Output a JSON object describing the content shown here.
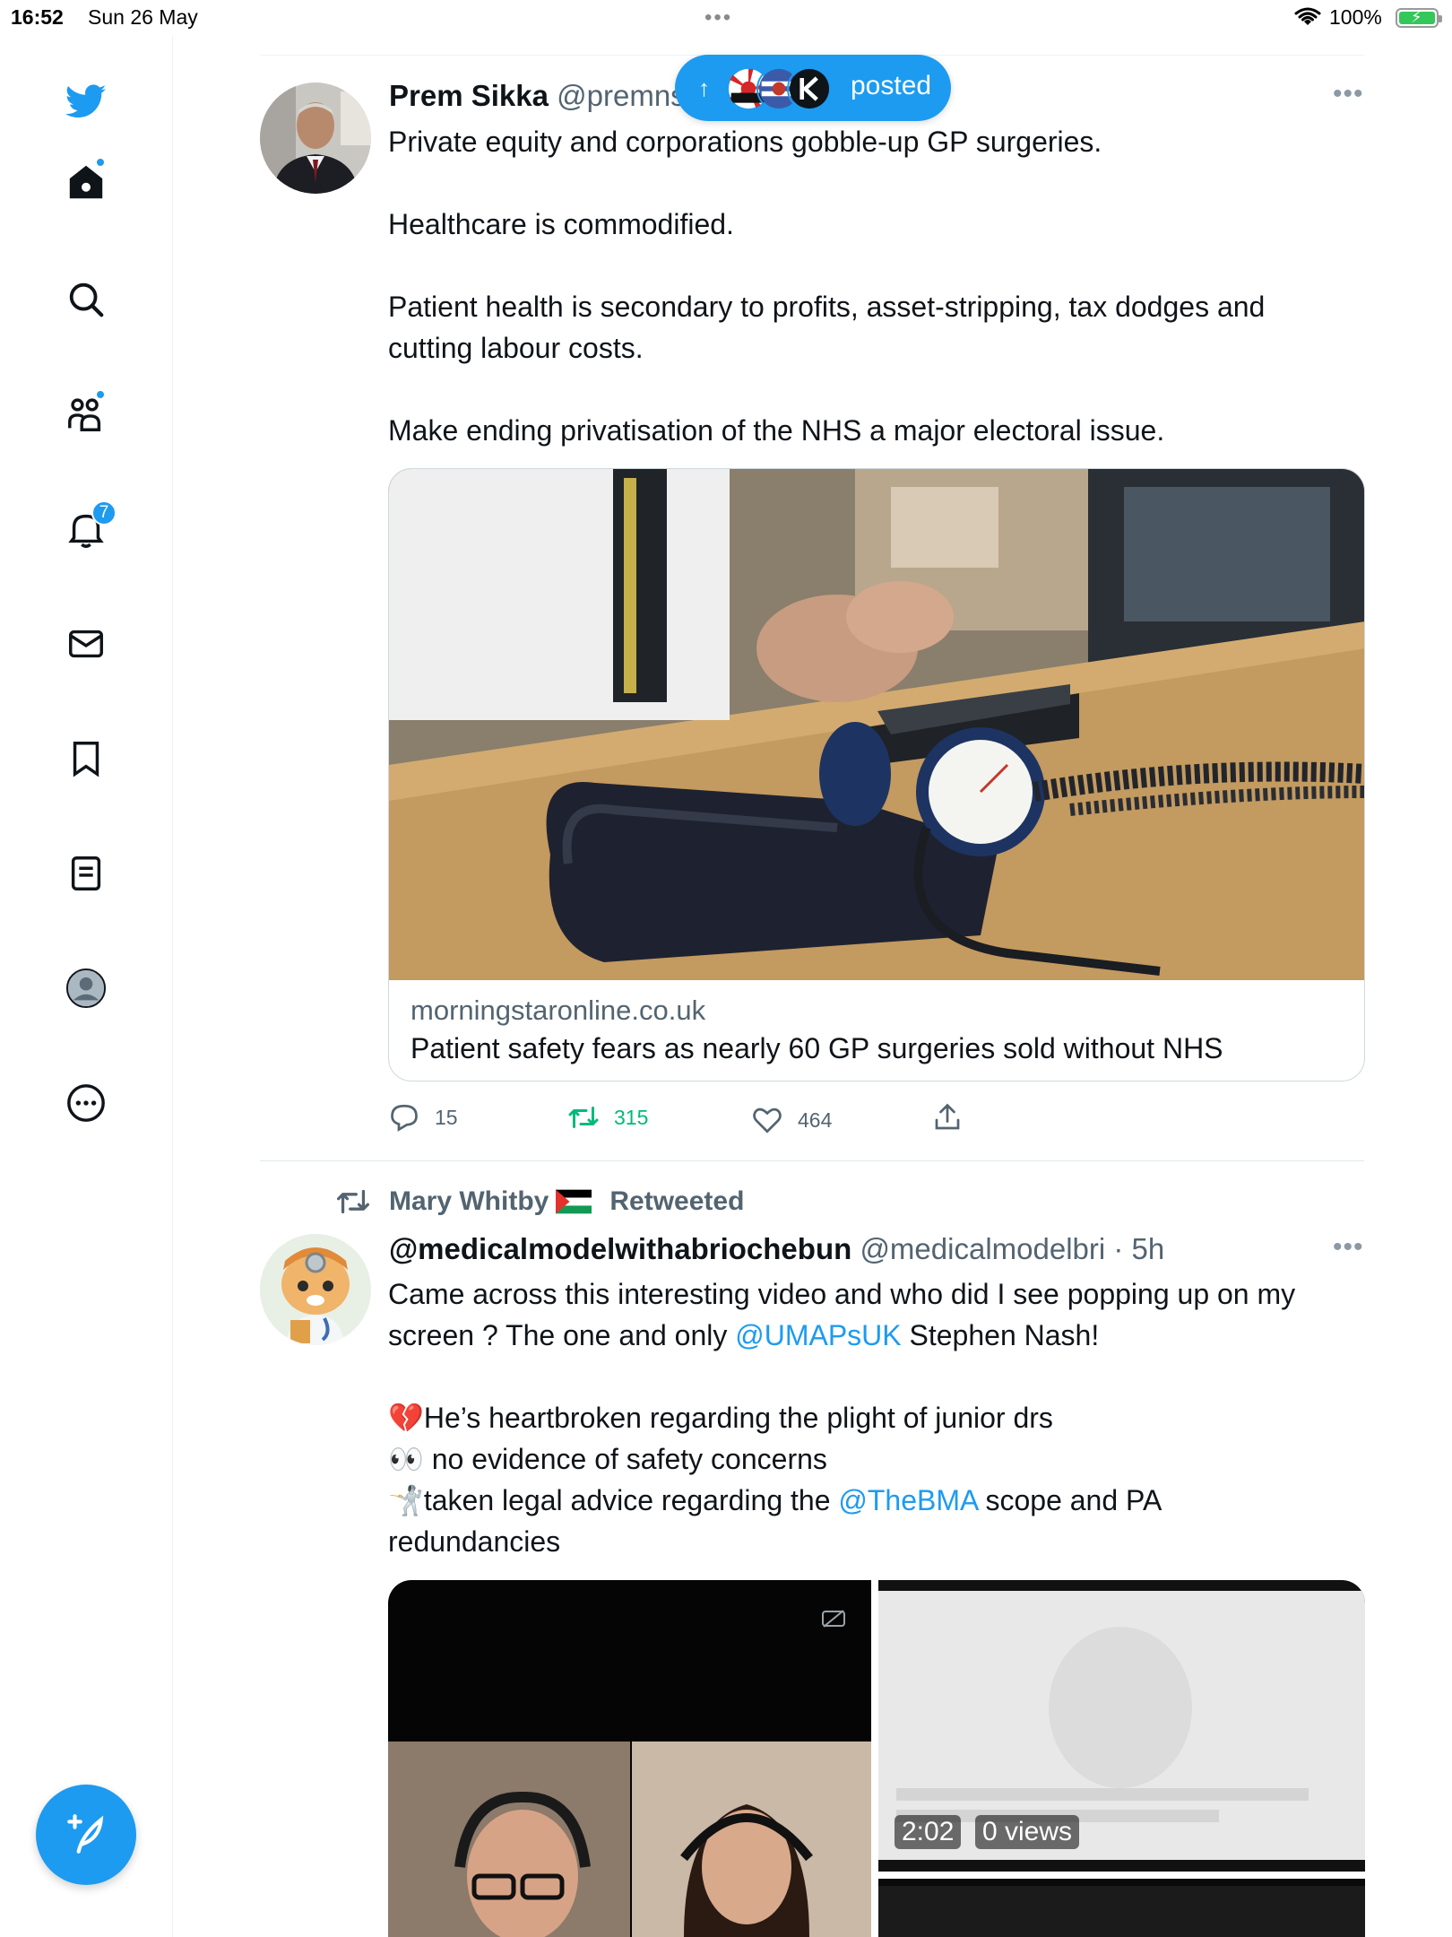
{
  "status_bar": {
    "time": "16:52",
    "date": "Sun 26 May",
    "battery": "100%"
  },
  "sidebar": {
    "items": [
      {
        "name": "home",
        "badge": ""
      },
      {
        "name": "search",
        "badge": ""
      },
      {
        "name": "communities",
        "badge": ""
      },
      {
        "name": "notifications",
        "badge": "7"
      },
      {
        "name": "messages",
        "badge": ""
      },
      {
        "name": "bookmarks",
        "badge": ""
      },
      {
        "name": "lists",
        "badge": ""
      },
      {
        "name": "profile",
        "badge": ""
      },
      {
        "name": "more",
        "badge": ""
      }
    ]
  },
  "posted_pill": {
    "label": "posted"
  },
  "tweet1": {
    "name": "Prem Sikka",
    "handle": "@premns",
    "text_lines": [
      "Private equity and corporations gobble-up GP surgeries.",
      "Healthcare is commodified.",
      "Patient health is secondary to profits, asset-stripping,  tax dodges and",
      "cutting labour costs.",
      "Make ending privatisation of the NHS a major electoral issue."
    ],
    "card": {
      "domain": "morningstaronline.co.uk",
      "title": "Patient safety fears as nearly 60 GP surgeries sold without NHS"
    },
    "actions": {
      "replies": "15",
      "retweets": "315",
      "likes": "464"
    }
  },
  "tweet2": {
    "retweeted_by": "Mary Whitby",
    "retweeted_label": "Retweeted",
    "name": "@medicalmodelwithabriochebun",
    "handle": "@medicalmodelbri",
    "time": "· 5h",
    "text": {
      "l1": "Came across this interesting video and who did I see popping up on my",
      "l2a": "screen ? The one and only ",
      "l2_mention": "@UMAPsUK",
      "l2b": " Stephen Nash!",
      "l3": "💔He’s heartbroken regarding the plight of junior drs",
      "l4": "👀 no evidence of safety concerns",
      "l5a": "🤺taken legal advice regarding the ",
      "l5_mention": "@TheBMA",
      "l5b": " scope and PA",
      "l6": "redundancies"
    },
    "video": {
      "duration": "2:02",
      "views": "0 views"
    }
  },
  "colors": {
    "accent": "#1d9bf0",
    "retweet_green": "#00ba7c",
    "muted": "#536471"
  }
}
